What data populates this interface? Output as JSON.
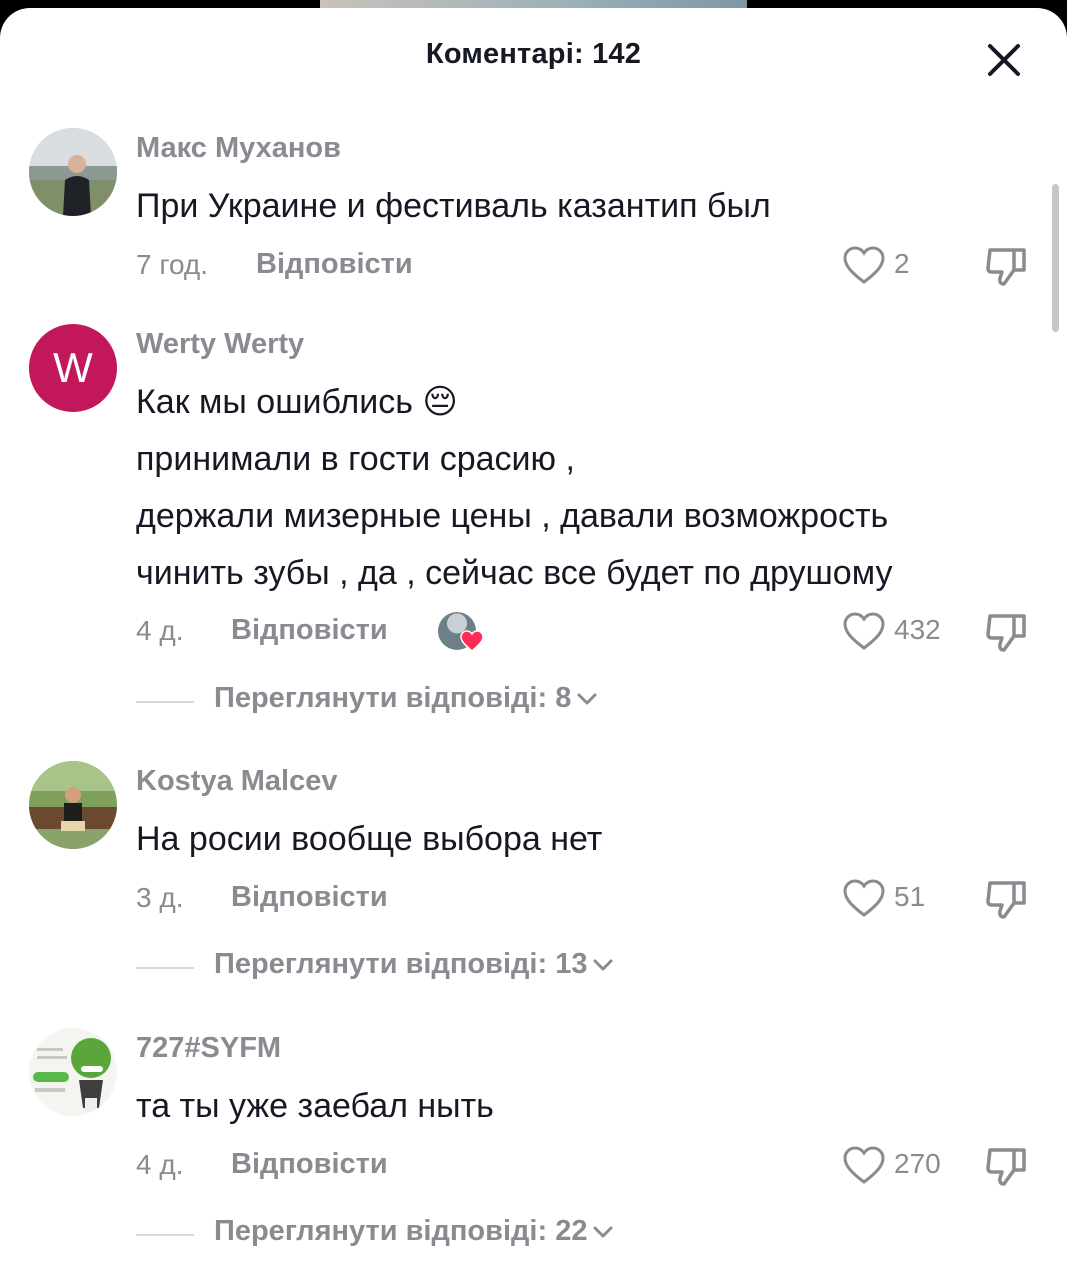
{
  "header": {
    "title": "Коментарі: 142"
  },
  "comments": [
    {
      "username": "Макс Муханов",
      "lines": [
        "При Украине и фестиваль казантип был"
      ],
      "time": "7 год.",
      "reply_label": "Відповісти",
      "likes": "2",
      "avatar_icon": "user-photo-avatar"
    },
    {
      "username": "Werty Werty",
      "lines": [
        "Как мы ошиблись 😔",
        "принимали в гости срасию ,",
        "держали мизерные цены , давали возможрость",
        "чинить зубы , да , сейчас все будет по друшому"
      ],
      "time": "4 д.",
      "reply_label": "Відповісти",
      "likes": "432",
      "avatar_letter": "W",
      "avatar_color": "#c2185b",
      "view_replies": "Переглянути відповіді: 8"
    },
    {
      "username": "Kostya Malcev",
      "lines": [
        "На росии вообще выбора нет"
      ],
      "time": "3 д.",
      "reply_label": "Відповісти",
      "likes": "51",
      "avatar_icon": "user-photo-avatar",
      "view_replies": "Переглянути відповіді: 13"
    },
    {
      "username": "727#SYFM",
      "lines": [
        "та ты уже заебал ныть"
      ],
      "time": "4 д.",
      "reply_label": "Відповісти",
      "likes": "270",
      "avatar_icon": "user-photo-avatar",
      "view_replies": "Переглянути відповіді: 22"
    }
  ]
}
